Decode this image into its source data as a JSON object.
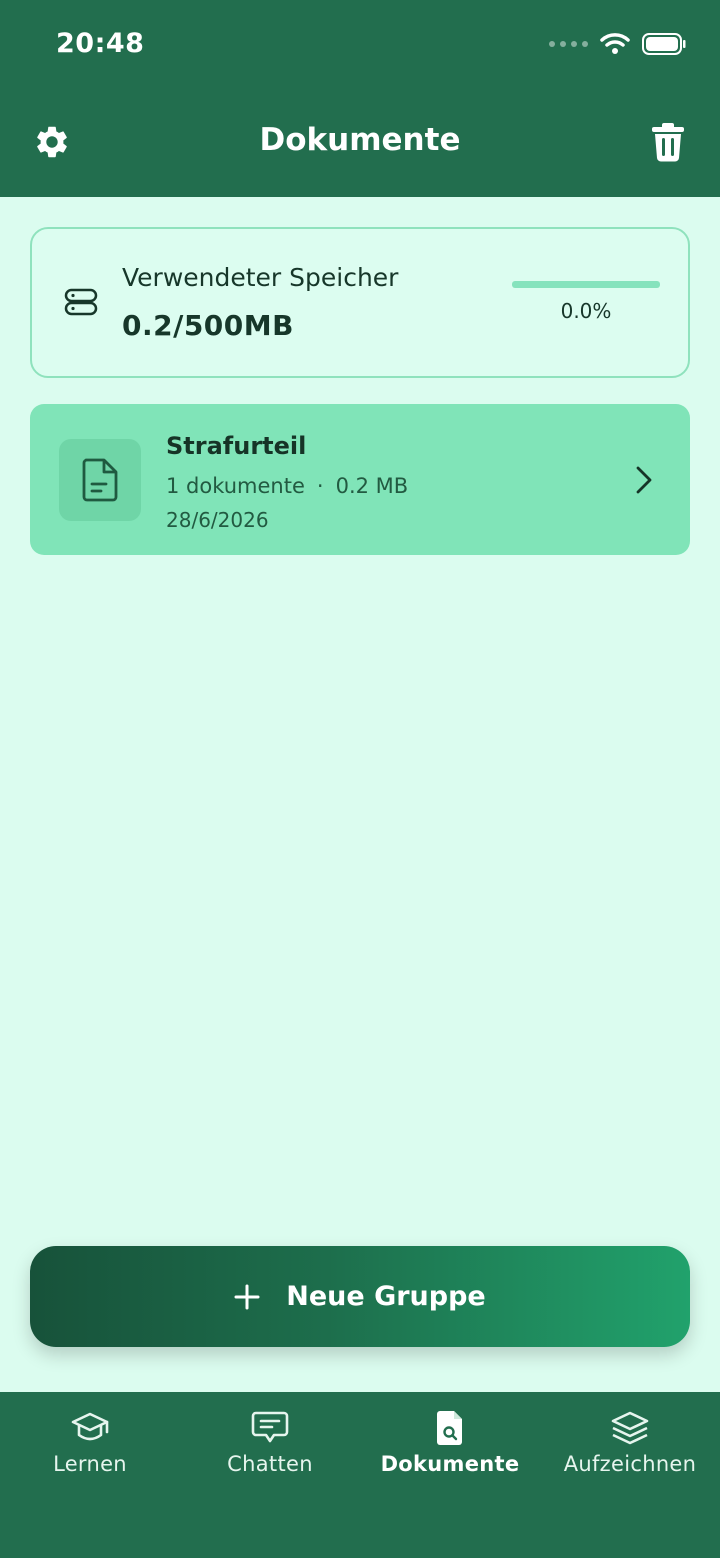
{
  "status_bar": {
    "time": "20:48"
  },
  "header": {
    "title": "Dokumente"
  },
  "storage": {
    "label": "Verwendeter Speicher",
    "value": "0.2/500MB",
    "percent_text": "0.0%",
    "fill_fraction": 0.0
  },
  "groups": [
    {
      "title": "Strafurteil",
      "count": "1 dokumente",
      "separator": "·",
      "size": "0.2 MB",
      "date": "28/6/2026"
    }
  ],
  "actions": {
    "new_group": "Neue Gruppe"
  },
  "nav": {
    "items": [
      {
        "label": "Lernen",
        "icon": "graduation-cap-icon"
      },
      {
        "label": "Chatten",
        "icon": "chat-bubble-icon"
      },
      {
        "label": "Dokumente",
        "icon": "document-search-icon"
      },
      {
        "label": "Aufzeichnen",
        "icon": "layers-icon"
      }
    ],
    "active": "Dokumente"
  },
  "colors": {
    "primary": "#226e4e",
    "background": "#dbfcef",
    "card_accent": "#80e4b8"
  }
}
